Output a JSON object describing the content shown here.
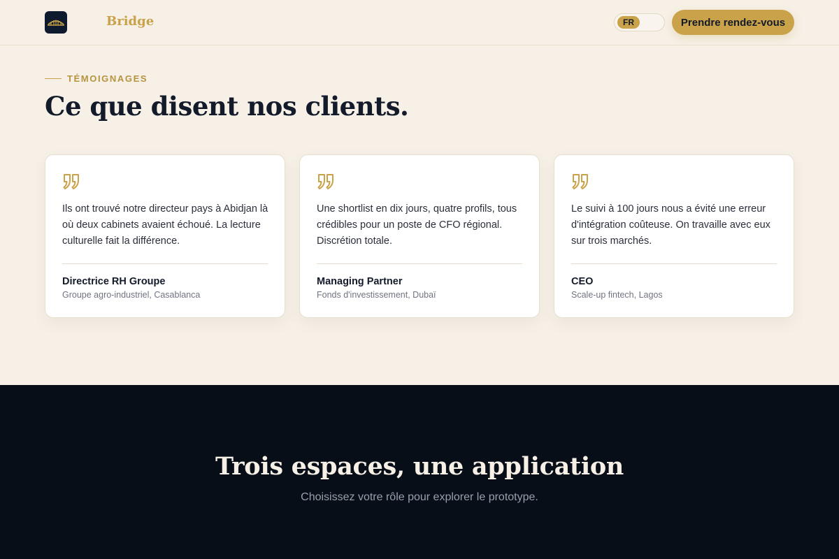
{
  "header": {
    "brand": "Bridge",
    "lang": "FR",
    "cta_label": "Prendre rendez-vous"
  },
  "colors": {
    "accent": "#c9a24a",
    "navy": "#0f1a2e",
    "background": "#f6f0e6",
    "dark_section": "#070e18"
  },
  "testimonials": {
    "eyebrow": "TÉMOIGNAGES",
    "title": "Ce que disent nos clients.",
    "cards": [
      {
        "quote": "Ils ont trouvé notre directeur pays à Abidjan là où deux cabinets avaient échoué. La lecture culturelle fait la différence.",
        "name": "Directrice RH Groupe",
        "company": "Groupe agro-industriel, Casablanca"
      },
      {
        "quote": "Une shortlist en dix jours, quatre profils, tous crédibles pour un poste de CFO régional. Discrétion totale.",
        "name": "Managing Partner",
        "company": "Fonds d'investissement, Dubaï"
      },
      {
        "quote": "Le suivi à 100 jours nous a évité une erreur d'intégration coûteuse. On travaille avec eux sur trois marchés.",
        "name": "CEO",
        "company": "Scale-up fintech, Lagos"
      }
    ]
  },
  "spaces": {
    "title": "Trois espaces, une application",
    "subtitle": "Choisissez votre rôle pour explorer le prototype."
  },
  "icons": {
    "logo": "bridge-logo-icon",
    "quote": "quote-icon"
  }
}
